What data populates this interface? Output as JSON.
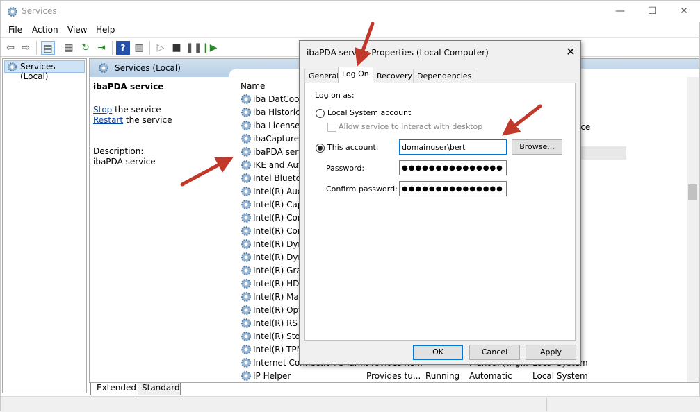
{
  "window": {
    "title": "Services",
    "minimize": "—",
    "maximize": "☐",
    "close": "✕"
  },
  "menu": [
    "File",
    "Action",
    "View",
    "Help"
  ],
  "tree": {
    "root": "Services (Local)"
  },
  "pane": {
    "header": "Services (Local)",
    "service_title": "ibaPDA service",
    "stop_link": "Stop",
    "stop_rest": " the service",
    "restart_link": "Restart",
    "restart_rest": " the service",
    "description_label": "Description:",
    "description_text": "ibaPDA service",
    "column_name": "Name"
  },
  "services": [
    {
      "name": "iba DatCoord",
      "desc": "",
      "status": "",
      "startup": "",
      "logon": ""
    },
    {
      "name": "iba Historical",
      "desc": "",
      "status": "",
      "startup": "",
      "logon": ""
    },
    {
      "name": "iba License S",
      "desc": "",
      "status": "",
      "startup": "",
      "logon": ""
    },
    {
      "name": "ibaCapture se",
      "desc": "",
      "status": "",
      "startup": "",
      "logon": ""
    },
    {
      "name": "ibaPDA servic",
      "desc": "",
      "status": "",
      "startup": "",
      "logon": ""
    },
    {
      "name": "IKE and Auth",
      "desc": "",
      "status": "",
      "startup": "",
      "logon": ""
    },
    {
      "name": "Intel Blueto",
      "desc": "",
      "status": "",
      "startup": "",
      "logon": ""
    },
    {
      "name": "Intel(R) Audi",
      "desc": "",
      "status": "",
      "startup": "",
      "logon": ""
    },
    {
      "name": "Intel(R) Capa",
      "desc": "",
      "status": "",
      "startup": "",
      "logon": ""
    },
    {
      "name": "Intel(R) Conte",
      "desc": "",
      "status": "",
      "startup": "",
      "logon": ""
    },
    {
      "name": "Intel(R) Conte",
      "desc": "",
      "status": "",
      "startup": "",
      "logon": ""
    },
    {
      "name": "Intel(R) Dyna",
      "desc": "",
      "status": "",
      "startup": "",
      "logon": ""
    },
    {
      "name": "Intel(R) Dyna",
      "desc": "",
      "status": "",
      "startup": "",
      "logon": ""
    },
    {
      "name": "Intel(R) Grapl",
      "desc": "",
      "status": "",
      "startup": "",
      "logon": ""
    },
    {
      "name": "Intel(R) HD G",
      "desc": "",
      "status": "",
      "startup": "",
      "logon": ""
    },
    {
      "name": "Intel(R) Mana",
      "desc": "",
      "status": "",
      "startup": "",
      "logon": ""
    },
    {
      "name": "Intel(R) Optai",
      "desc": "",
      "status": "",
      "startup": "",
      "logon": ""
    },
    {
      "name": "Intel(R) RST H",
      "desc": "",
      "status": "",
      "startup": "",
      "logon": ""
    },
    {
      "name": "Intel(R) Stora",
      "desc": "",
      "status": "",
      "startup": "",
      "logon": ""
    },
    {
      "name": "Intel(R) TPM",
      "desc": "",
      "status": "",
      "startup": "",
      "logon": ""
    },
    {
      "name": "Internet Connection Shari...",
      "desc": "Provides ne...",
      "status": "",
      "startup": "Manual (Trig...",
      "logon": "Local System"
    },
    {
      "name": "IP Helper",
      "desc": "Provides tu...",
      "status": "Running",
      "startup": "Automatic",
      "logon": "Local System"
    }
  ],
  "partial_text": {
    "ice": "ice"
  },
  "bottom_tabs": {
    "extended": "Extended",
    "standard": "Standard"
  },
  "dialog": {
    "title": "ibaPDA service Properties (Local Computer)",
    "close": "✕",
    "tabs": [
      "General",
      "Log On",
      "Recovery",
      "Dependencies"
    ],
    "active_tab": "Log On",
    "log_on_as": "Log on as:",
    "local_system": "Local System account",
    "allow_desktop": "Allow service to interact with desktop",
    "this_account": "This account:",
    "account_value": "domainuser\\bert",
    "browse": "Browse...",
    "password_label": "Password:",
    "password_value": "●●●●●●●●●●●●●●●",
    "confirm_label": "Confirm password:",
    "confirm_value": "●●●●●●●●●●●●●●●",
    "ok": "OK",
    "cancel": "Cancel",
    "apply": "Apply"
  },
  "colors": {
    "accent": "#0078d7",
    "arrow": "#c0392b",
    "header": "#c4d8ec",
    "selection": "#cfe3f7"
  }
}
